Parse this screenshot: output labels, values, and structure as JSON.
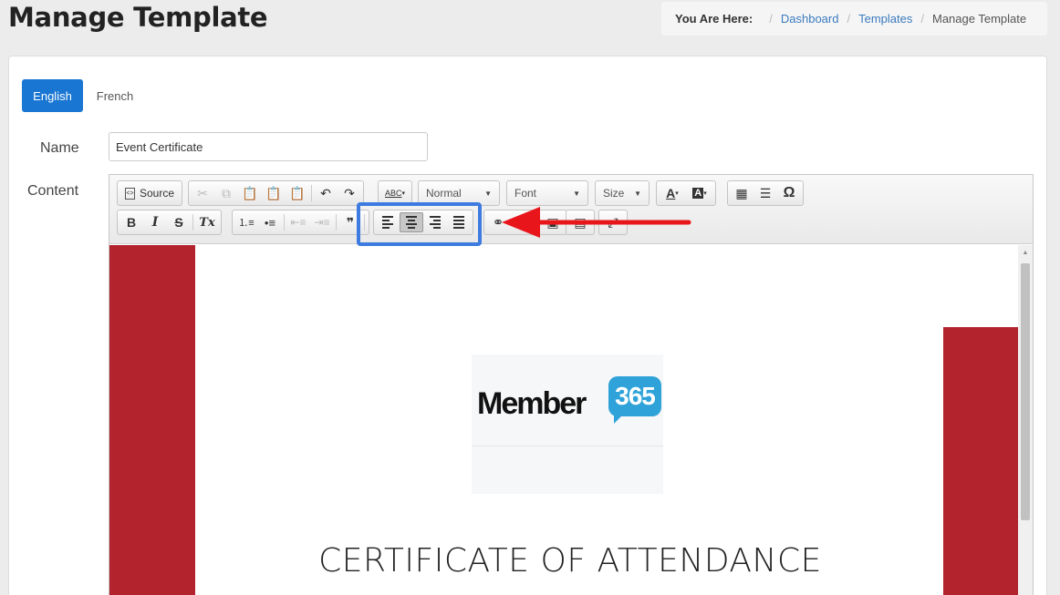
{
  "page": {
    "title": "Manage Template"
  },
  "breadcrumb": {
    "label": "You Are Here:",
    "items": [
      "Dashboard",
      "Templates"
    ],
    "current": "Manage Template"
  },
  "tabs": [
    {
      "label": "English",
      "active": true
    },
    {
      "label": "French",
      "active": false
    }
  ],
  "form": {
    "name_label": "Name",
    "name_value": "Event Certificate",
    "content_label": "Content"
  },
  "toolbar": {
    "source_label": "Source",
    "format_value": "Normal",
    "font_value": "Font",
    "size_value": "Size",
    "text_color_label": "A",
    "bg_color_label": "A",
    "omega": "Ω",
    "bold": "B",
    "italic": "I",
    "strike": "S",
    "remove_format": "Tx",
    "blockquote": "❞",
    "spellcheck": "ABC"
  },
  "document": {
    "logo_text": "Member",
    "logo_badge": "365",
    "certificate_title": "CERTIFICATE OF ATTENDANCE"
  },
  "colors": {
    "accent": "#1976d2",
    "certificate_red": "#b2232e",
    "highlight": "#3d7be0",
    "arrow": "#e8151b",
    "logo_blue": "#2fa3d9"
  }
}
